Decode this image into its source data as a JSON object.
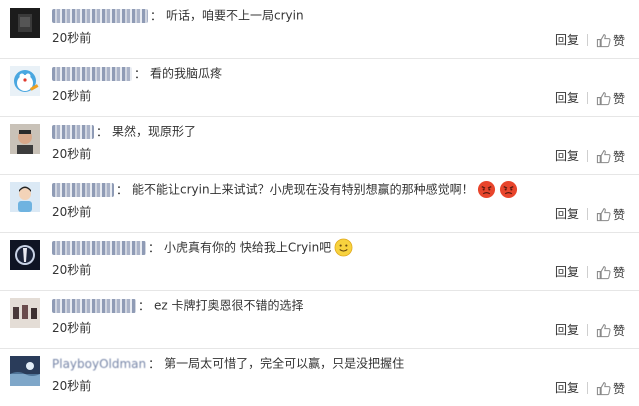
{
  "comments": [
    {
      "text": "听话，咱要不上一局cryin",
      "time": "20秒前",
      "reply_label": "回复",
      "like_label": "赞"
    },
    {
      "text": "看的我脑瓜疼",
      "time": "20秒前",
      "reply_label": "回复",
      "like_label": "赞"
    },
    {
      "text": "果然，现原形了",
      "time": "20秒前",
      "reply_label": "回复",
      "like_label": "赞"
    },
    {
      "text": "能不能让cryin上来试试？小虎现在没有特别想赢的那种感觉啊！",
      "time": "20秒前",
      "reply_label": "回复",
      "like_label": "赞"
    },
    {
      "text": "小虎真有你的 快给我上Cryin吧",
      "time": "20秒前",
      "reply_label": "回复",
      "like_label": "赞"
    },
    {
      "text": "ez 卡牌打奥恩很不错的选择",
      "time": "20秒前",
      "reply_label": "回复",
      "like_label": "赞"
    },
    {
      "username": "PlayboyOldman",
      "text": "第一局太可惜了，完全可以赢，只是没把握住",
      "time": "20秒前",
      "reply_label": "回复",
      "like_label": "赞"
    }
  ],
  "colors": {
    "text": "#333333",
    "username": "#7786a8",
    "divider": "#e6e6e6",
    "icon": "#8a8a8a"
  }
}
